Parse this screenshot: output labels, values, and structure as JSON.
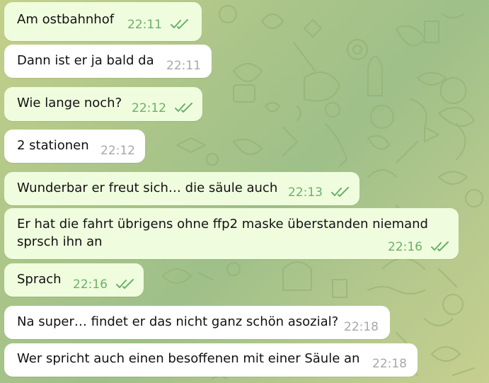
{
  "chat": {
    "accent_out_bubble": "#effdde",
    "accent_in_bubble": "#ffffff",
    "accent_time_out": "#6bb06a",
    "messages": [
      {
        "text": "Am ostbahnhof",
        "time": "22:11",
        "direction": "out",
        "read": true
      },
      {
        "text": "Dann ist er ja bald da",
        "time": "22:11",
        "direction": "in",
        "read": false
      },
      {
        "text": "Wie lange noch?",
        "time": "22:12",
        "direction": "out",
        "read": true
      },
      {
        "text": "2 stationen",
        "time": "22:12",
        "direction": "in",
        "read": false
      },
      {
        "text": "Wunderbar er freut sich… die säule auch",
        "time": "22:13",
        "direction": "out",
        "read": true
      },
      {
        "text_line1": "Er hat die fahrt übrigens ohne ffp2 maske überstanden niemand",
        "text_line2": "sprsch ihn an",
        "time": "22:16",
        "direction": "out",
        "read": true
      },
      {
        "text": "Sprach",
        "time": "22:16",
        "direction": "out",
        "read": true
      },
      {
        "text": "Na super… findet er das nicht ganz schön asozial?",
        "time": "22:18",
        "direction": "in",
        "read": false
      },
      {
        "text": "Wer spricht auch einen besoffenen mit einer Säule an",
        "time": "22:18",
        "direction": "in",
        "read": false
      }
    ]
  }
}
